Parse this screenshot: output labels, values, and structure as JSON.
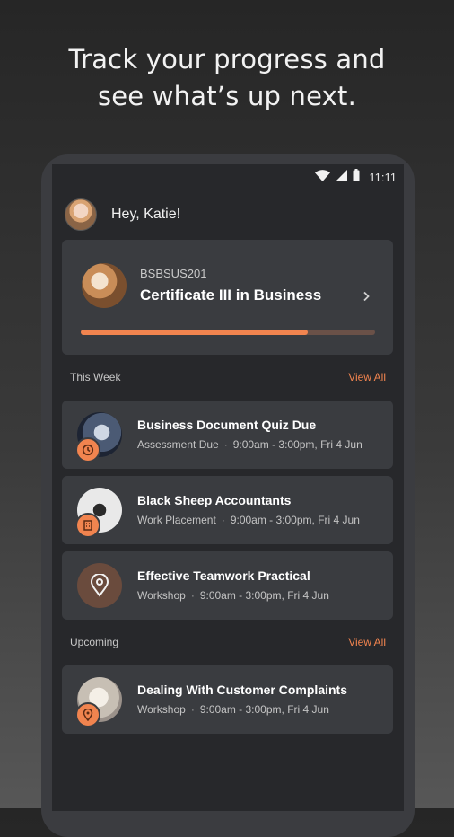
{
  "headline": {
    "line1": "Track your progress and",
    "line2": "see what’s up next."
  },
  "status_bar": {
    "time": "11:11",
    "icons": [
      "wifi-icon",
      "signal-icon",
      "battery-icon"
    ]
  },
  "greeting": {
    "text": "Hey, Katie!"
  },
  "course": {
    "code": "BSBSUS201",
    "name": "Certificate III in Business",
    "progress": 0.77
  },
  "this_week": {
    "title": "This Week",
    "view_all": "View All",
    "items": [
      {
        "title": "Business Document Quiz Due",
        "type": "Assessment Due",
        "time": "9:00am - 3:00pm, Fri 4 Jun",
        "badge_icon": "clock-icon"
      },
      {
        "title": "Black Sheep Accountants",
        "type": "Work Placement",
        "time": "9:00am - 3:00pm, Fri 4 Jun",
        "badge_icon": "building-icon"
      },
      {
        "title": "Effective Teamwork Practical",
        "type": "Workshop",
        "time": "9:00am - 3:00pm, Fri 4 Jun",
        "badge_icon": "location-pin-icon"
      }
    ]
  },
  "upcoming": {
    "title": "Upcoming",
    "view_all": "View All",
    "items": [
      {
        "title": "Dealing With Customer Complaints",
        "type": "Workshop",
        "time": "9:00am - 3:00pm, Fri 4 Jun",
        "badge_icon": "location-pin-icon"
      }
    ]
  },
  "colors": {
    "accent": "#f1844f",
    "card": "#3a3c40",
    "screen": "#27282b"
  }
}
